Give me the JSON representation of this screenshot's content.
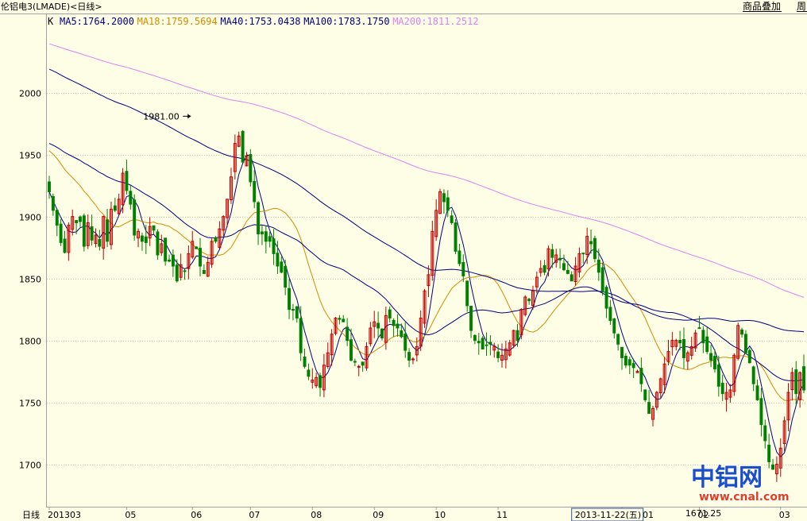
{
  "header": {
    "title": "伦铝电3(LMADE)<日线>",
    "overlay_button": "商品叠加",
    "period_button": "周"
  },
  "chart_data": {
    "type": "candlestick",
    "instrument": "伦铝电3(LMADE)",
    "period": "日线",
    "y_ticks": [
      2000,
      1950,
      1900,
      1850,
      1800,
      1750,
      1700
    ],
    "ylim": [
      1667,
      2062
    ],
    "xlim": [
      0,
      195
    ],
    "x_ticks": [
      {
        "label": "201303",
        "x": 0
      },
      {
        "label": "05",
        "x": 20
      },
      {
        "label": "06",
        "x": 37
      },
      {
        "label": "07",
        "x": 52
      },
      {
        "label": "08",
        "x": 68
      },
      {
        "label": "09",
        "x": 84
      },
      {
        "label": "10",
        "x": 100
      },
      {
        "label": "11",
        "x": 116
      },
      {
        "label": "201401",
        "x": 148
      },
      {
        "label": "02",
        "x": 168
      },
      {
        "label": "03",
        "x": 189
      }
    ],
    "axis_name_label": "日线",
    "cursor_date_label": "2013-11-22(五)",
    "cursor_x": 135,
    "hud_prefix": "K",
    "ma_legend": [
      {
        "label": "MA5:1764.2000",
        "color": "#000080"
      },
      {
        "label": "MA18:1759.5694",
        "color": "#d28c00"
      },
      {
        "label": "MA40:1753.0438",
        "color": "#000080"
      },
      {
        "label": "MA100:1783.1750",
        "color": "#000080"
      },
      {
        "label": "MA200:1811.2512",
        "color": "#e080f0"
      }
    ],
    "annotations": [
      {
        "text": "1981.00",
        "x": 37,
        "y": 1981,
        "kind": "high"
      },
      {
        "text": "1671.25",
        "x": 173,
        "y": 1671,
        "kind": "low"
      }
    ],
    "colors": {
      "up": "#c00000",
      "down": "#008000",
      "grid": "#c8c8b4",
      "axis": "#a0a0a0"
    },
    "closes": [
      1920,
      1905,
      1893,
      1879,
      1871,
      1893,
      1900,
      1895,
      1896,
      1876,
      1895,
      1881,
      1885,
      1876,
      1900,
      1880,
      1906,
      1905,
      1914,
      1935,
      1921,
      1910,
      1885,
      1888,
      1880,
      1879,
      1892,
      1889,
      1869,
      1878,
      1864,
      1864,
      1860,
      1848,
      1861,
      1856,
      1870,
      1880,
      1874,
      1860,
      1854,
      1863,
      1880,
      1880,
      1890,
      1900,
      1914,
      1932,
      1959,
      1965,
      1944,
      1949,
      1928,
      1912,
      1886,
      1886,
      1880,
      1880,
      1870,
      1860,
      1855,
      1843,
      1825,
      1825,
      1818,
      1790,
      1779,
      1771,
      1768,
      1770,
      1762,
      1780,
      1790,
      1805,
      1818,
      1817,
      1815,
      1800,
      1784,
      1783,
      1779,
      1780,
      1795,
      1810,
      1815,
      1810,
      1802,
      1820,
      1818,
      1812,
      1810,
      1803,
      1792,
      1784,
      1785,
      1795,
      1818,
      1840,
      1853,
      1888,
      1905,
      1920,
      1912,
      1905,
      1895,
      1872,
      1862,
      1852,
      1828,
      1808,
      1800,
      1798,
      1793,
      1796,
      1797,
      1795,
      1786,
      1788,
      1793,
      1798,
      1808,
      1800,
      1825,
      1835,
      1832,
      1840,
      1851,
      1858,
      1855,
      1874,
      1867,
      1869,
      1865,
      1857,
      1854,
      1848,
      1860,
      1870,
      1870,
      1884,
      1878,
      1866,
      1855,
      1840,
      1826,
      1816,
      1806,
      1797,
      1786,
      1780,
      1780,
      1778,
      1775,
      1765,
      1752,
      1741,
      1745,
      1758,
      1769,
      1781,
      1791,
      1800,
      1800,
      1798,
      1786,
      1790,
      1795,
      1806,
      1810,
      1798,
      1791,
      1784,
      1777,
      1763,
      1757,
      1758,
      1760,
      1788,
      1812,
      1805,
      1790,
      1782,
      1765,
      1752,
      1732,
      1719,
      1702,
      1696,
      1700,
      1713,
      1735,
      1758,
      1774,
      1757,
      1774,
      1760
    ]
  }
}
